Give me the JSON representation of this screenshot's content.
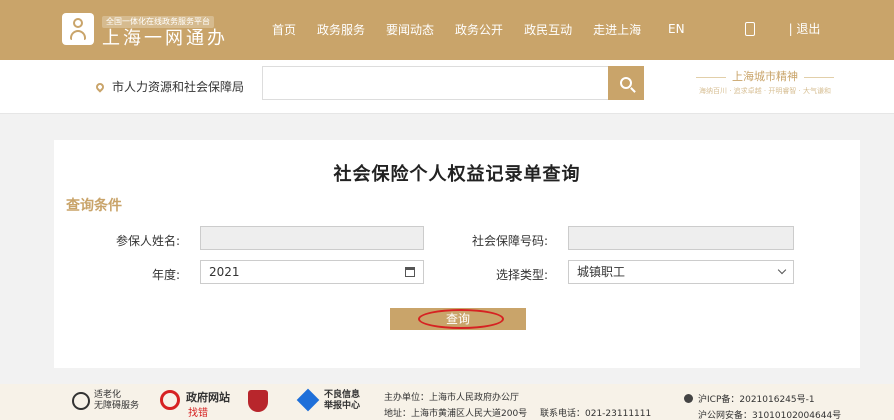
{
  "header": {
    "platform_tag": "全国一体化在线政务服务平台",
    "brand_name": "上海一网通办",
    "nav": [
      "首页",
      "政务服务",
      "要闻动态",
      "政务公开",
      "政民互动",
      "走进上海"
    ],
    "lang": "EN",
    "logout": "| 退出"
  },
  "search": {
    "department": "市人力资源和社会保障局",
    "placeholder": "",
    "city_title": "上海城市精神",
    "city_sub": "海纳百川 · 追求卓越 · 开明睿智 · 大气谦和"
  },
  "form": {
    "title": "社会保险个人权益记录单查询",
    "section": "查询条件",
    "name_label": "参保人姓名:",
    "name_value": "",
    "ssn_label": "社会保障号码:",
    "ssn_value": "",
    "year_label": "年度:",
    "year_value": "2021",
    "type_label": "选择类型:",
    "type_value": "城镇职工",
    "query_button": "查询"
  },
  "footer": {
    "access_text": "适老化\n无障碍服务",
    "gov_site": "政府网站",
    "gov_site_sub": "找错",
    "report": "不良信息\n举报中心",
    "host": "主办单位：上海市人民政府办公厅",
    "address": "地址：上海市黄浦区人民大道200号",
    "phone": "联系电话：021-23111111",
    "icp": "沪ICP备：2021016245号-1",
    "police": "沪公网安备：31010102004644号"
  },
  "colors": {
    "accent": "#c9a46a",
    "highlight": "#d62222"
  }
}
